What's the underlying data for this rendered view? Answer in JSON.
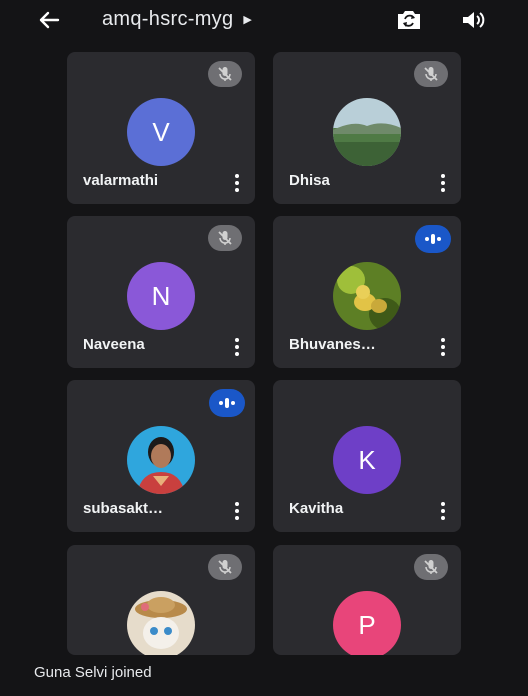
{
  "header": {
    "meeting_code": "amq-hsrc-myg",
    "back_icon": "arrow-left-icon",
    "switch_camera_icon": "switch-camera-icon",
    "speaker_icon": "speaker-icon"
  },
  "participants": [
    {
      "name": "valarmathi",
      "initial": "V",
      "avatar_color": "#5b6fd6",
      "mic": "muted"
    },
    {
      "name": "Dhisa",
      "initial": "",
      "avatar_color": "#8aa59a",
      "mic": "muted"
    },
    {
      "name": "Naveena",
      "initial": "N",
      "avatar_color": "#8a58d8",
      "mic": "muted"
    },
    {
      "name": "Bhuvanes…",
      "initial": "",
      "avatar_color": "#6c8f2c",
      "mic": "speaking"
    },
    {
      "name": "subasakt…",
      "initial": "",
      "avatar_color": "#3aa7d8",
      "mic": "speaking"
    },
    {
      "name": "Kavitha",
      "initial": "K",
      "avatar_color": "#6e3fc7",
      "mic": "none"
    },
    {
      "name": "",
      "initial": "",
      "avatar_color": "#d9c7a6",
      "mic": "muted"
    },
    {
      "name": "",
      "initial": "P",
      "avatar_color": "#e8457a",
      "mic": "muted"
    }
  ],
  "toast": {
    "text": "Guna Selvi joined"
  }
}
